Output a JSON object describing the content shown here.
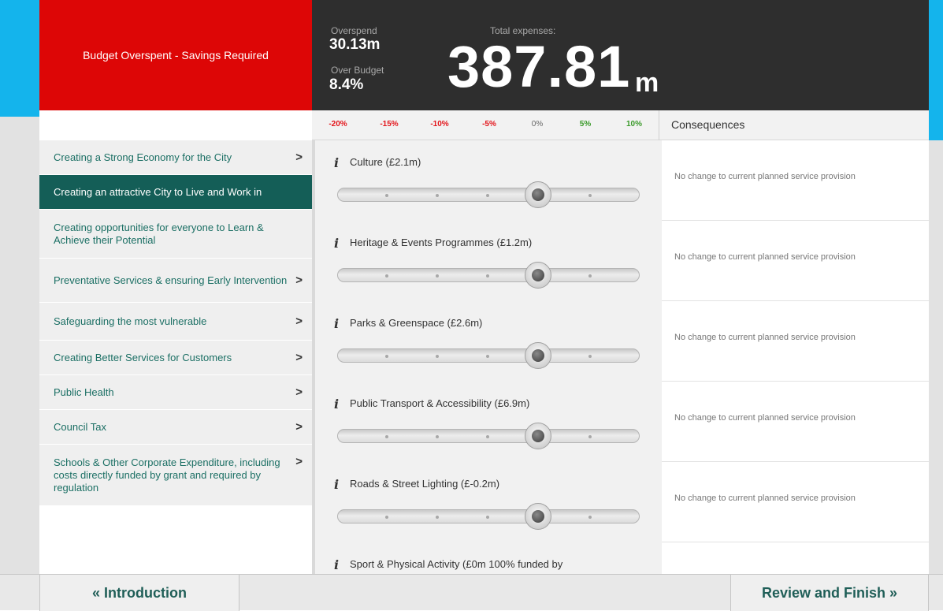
{
  "header": {
    "status_message": "Budget Overspent - Savings Required",
    "overspend_label": "Overspend",
    "overspend_value": "30.13m",
    "over_budget_label": "Over Budget",
    "over_budget_value": "8.4%",
    "total_label": "Total expenses:",
    "total_value": "387.81",
    "total_unit": "m"
  },
  "scale": {
    "ticks": [
      "-20%",
      "-15%",
      "-10%",
      "-5%",
      "0%",
      "5%",
      "10%"
    ],
    "consequences_label": "Consequences"
  },
  "nav": {
    "items": [
      {
        "label": "Creating a Strong Economy for the City",
        "active": false
      },
      {
        "label": "Creating an attractive City to Live and Work in",
        "active": true
      },
      {
        "label": "Creating opportunities for everyone to Learn & Achieve their Potential",
        "active": false
      },
      {
        "label": "Preventative Services & ensuring Early Intervention",
        "active": false
      },
      {
        "label": "Safeguarding the most vulnerable",
        "active": false
      },
      {
        "label": "Creating Better Services for Customers",
        "active": false
      },
      {
        "label": "Public Health",
        "active": false
      },
      {
        "label": "Council Tax",
        "active": false
      },
      {
        "label": "Schools & Other Corporate Expenditure, including costs directly funded by grant and required by regulation",
        "active": false
      }
    ],
    "chevron": ">"
  },
  "services": {
    "info_glyph": "i",
    "rows": [
      {
        "title": "Culture (£2.1m)",
        "consequence": "No change to current planned service provision",
        "slider_percent": 0
      },
      {
        "title": "Heritage & Events Programmes (£1.2m)",
        "consequence": "No change to current planned service provision",
        "slider_percent": 0
      },
      {
        "title": "Parks & Greenspace (£2.6m)",
        "consequence": "No change to current planned service provision",
        "slider_percent": 0
      },
      {
        "title": "Public Transport & Accessibility (£6.9m)",
        "consequence": "No change to current planned service provision",
        "slider_percent": 0
      },
      {
        "title": "Roads & Street Lighting (£-0.2m)",
        "consequence": "No change to current planned service provision",
        "slider_percent": 0
      },
      {
        "title": "Sport & Physical Activity (£0m 100% funded by",
        "consequence": "",
        "slider_percent": 0
      }
    ]
  },
  "footer": {
    "intro_label": "« Introduction",
    "finish_label": "Review and Finish »"
  },
  "colors": {
    "alert_red": "#dd0606",
    "accent_blue": "#14b4ec",
    "nav_active": "#145e57",
    "nav_text": "#1b6f64"
  }
}
